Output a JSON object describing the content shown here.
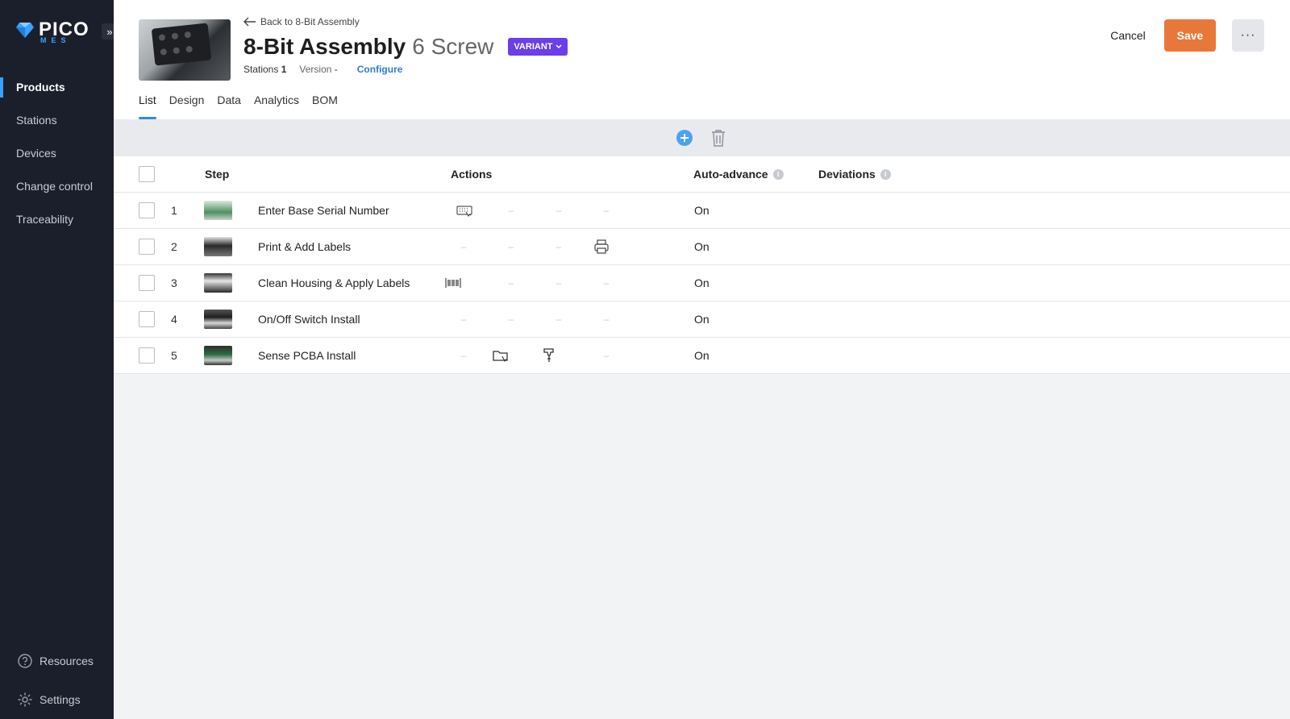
{
  "brand": {
    "name": "PICO",
    "sub": "MES"
  },
  "sidebar": {
    "collapse_glyph": "»",
    "items": [
      {
        "label": "Products",
        "active": true
      },
      {
        "label": "Stations"
      },
      {
        "label": "Devices"
      },
      {
        "label": "Change control"
      },
      {
        "label": "Traceability"
      }
    ],
    "bottom": [
      {
        "label": "Resources",
        "icon": "help-circle-icon"
      },
      {
        "label": "Settings",
        "icon": "gear-icon"
      }
    ]
  },
  "header": {
    "back_label": "Back to 8-Bit Assembly",
    "title": "8-Bit Assembly",
    "subtitle": "6 Screw",
    "variant_label": "VARIANT",
    "stations_label": "Stations",
    "stations_value": "1",
    "version_label": "Version",
    "version_value": "-",
    "configure_label": "Configure",
    "cancel_label": "Cancel",
    "save_label": "Save",
    "more_label": "···"
  },
  "tabs": [
    "List",
    "Design",
    "Data",
    "Analytics",
    "BOM"
  ],
  "table": {
    "headers": {
      "step": "Step",
      "actions": "Actions",
      "auto_advance": "Auto-advance",
      "deviations": "Deviations"
    },
    "rows": [
      {
        "num": "1",
        "name": "Enter Base Serial Number",
        "actions": [
          "keyboard-icon",
          "-",
          "-",
          "-"
        ],
        "auto": "On"
      },
      {
        "num": "2",
        "name": "Print & Add Labels",
        "actions": [
          "-",
          "-",
          "-",
          "printer-icon"
        ],
        "auto": "On"
      },
      {
        "num": "3",
        "name": "Clean Housing & Apply Labels",
        "actions": [
          "barcode-icon",
          "-",
          "-",
          "-"
        ],
        "auto": "On"
      },
      {
        "num": "4",
        "name": "On/Off Switch Install",
        "actions": [
          "-",
          "-",
          "-",
          "-"
        ],
        "auto": "On"
      },
      {
        "num": "5",
        "name": "Sense PCBA Install",
        "actions": [
          "-",
          "folder-click-icon",
          "screwdriver-icon",
          "-"
        ],
        "auto": "On"
      }
    ],
    "dash": "–"
  }
}
